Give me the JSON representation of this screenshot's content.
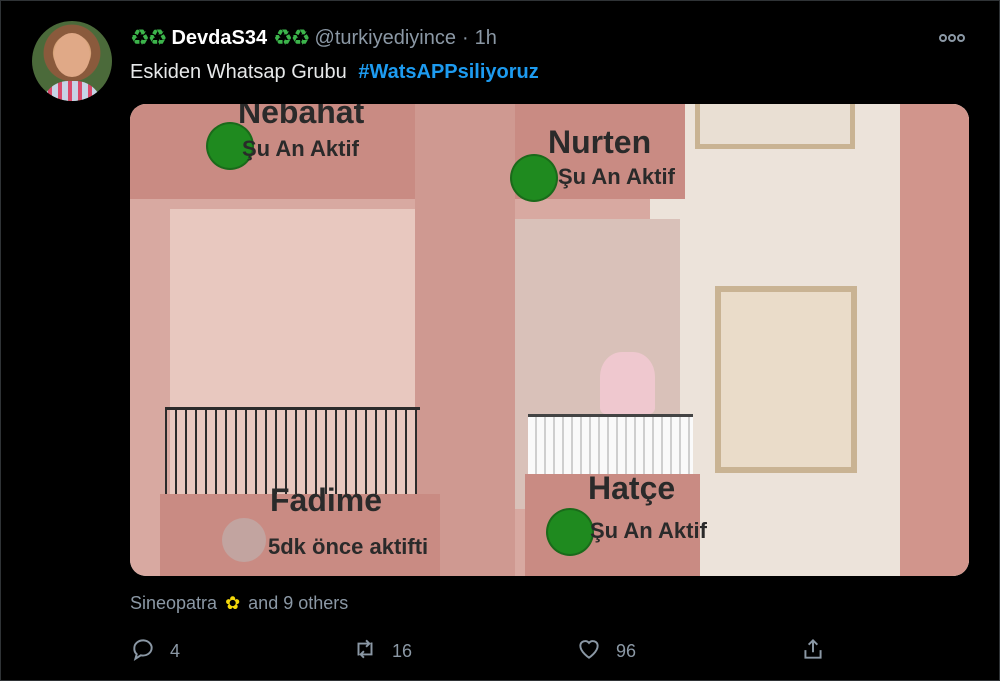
{
  "tweet": {
    "display_name": "DevdaS34",
    "name_decoration": "♻♻",
    "handle": "@turkiyediyince",
    "separator": "·",
    "time": "1h",
    "more_icon": "more-horizontal-icon",
    "text": "Eskiden Whatsap Grubu",
    "hashtag": "#WatsAPPsiliyoruz"
  },
  "media": {
    "labels": [
      {
        "name": "Nebahat",
        "status": "Şu An Aktif",
        "dot": "green"
      },
      {
        "name": "Nurten",
        "status": "Şu An Aktif",
        "dot": "green"
      },
      {
        "name": "Fadime",
        "status": "5dk önce aktifti",
        "dot": "gray"
      },
      {
        "name": "Hatçe",
        "status": "Şu An Aktif",
        "dot": "green"
      }
    ]
  },
  "social_context": {
    "first_name": "Sineopatra",
    "rest": "and 9 others"
  },
  "actions": {
    "reply_count": "4",
    "retweet_count": "16",
    "like_count": "96"
  },
  "colors": {
    "background": "#000000",
    "hashtag": "#1d9bf0",
    "muted": "#8b98a5",
    "active_green": "#1f8a1f"
  }
}
